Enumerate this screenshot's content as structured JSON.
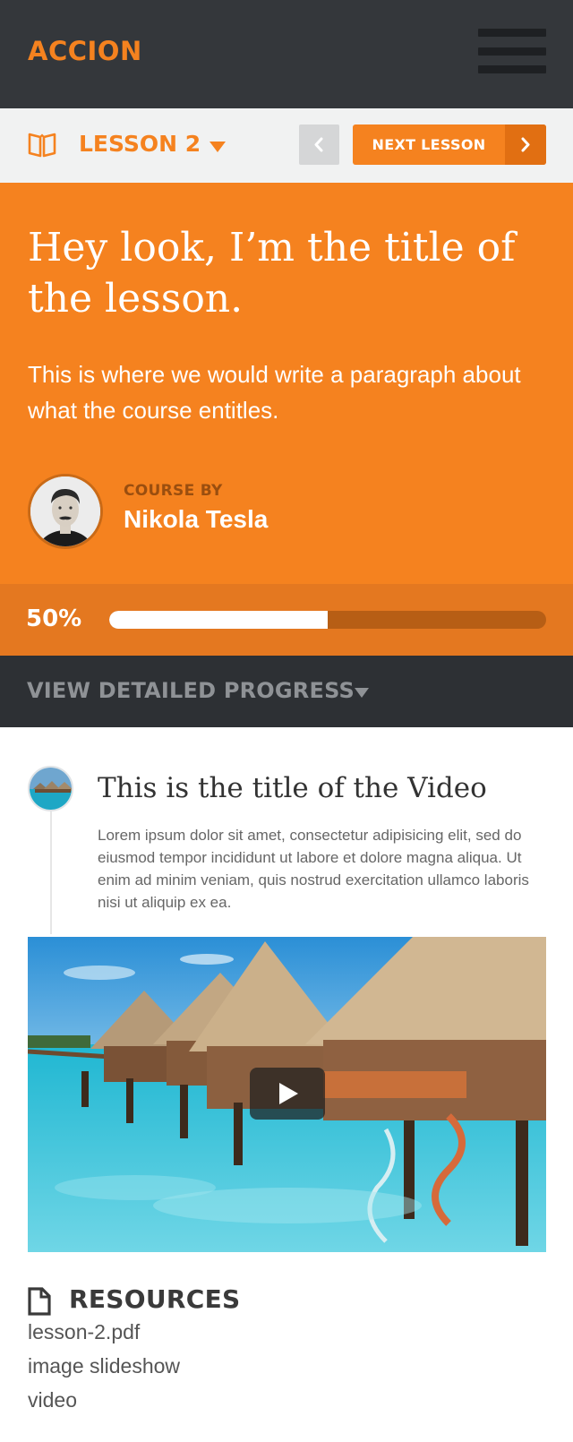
{
  "header": {
    "logo": "ACCION",
    "menu_icon": "hamburger-menu-icon",
    "background": "#34373b",
    "accent": "#f5821f"
  },
  "lesson_nav": {
    "icon": "book-icon",
    "lesson_label": "LESSON 2",
    "prev_icon": "chevron-left-icon",
    "next_label": "NEXT LESSON",
    "next_icon": "chevron-right-icon"
  },
  "hero": {
    "title": "Hey look, I’m the title of the lesson.",
    "description": "This is where we would write a paragraph about what the course entitles.",
    "course_by_label": "COURSE BY",
    "author": "Nikola Tesla"
  },
  "progress": {
    "percent_label": "50%",
    "value": 0.5
  },
  "detail_progress": {
    "label": "VIEW DETAILED PROGRESS",
    "icon": "caret-down-icon"
  },
  "video": {
    "title": "This is the title of the Video",
    "description": "Lorem ipsum dolor sit amet, consectetur adipisicing elit, sed do eiusmod tempor incididunt ut labore et dolore magna aliqua. Ut enim ad minim veniam, quis nostrud exercitation ullamco laboris nisi ut aliquip ex ea.",
    "play_icon": "play-icon"
  },
  "resources": {
    "icon": "document-icon",
    "title": "RESOURCES",
    "items": [
      "lesson-2.pdf",
      "image slideshow",
      "video"
    ]
  }
}
